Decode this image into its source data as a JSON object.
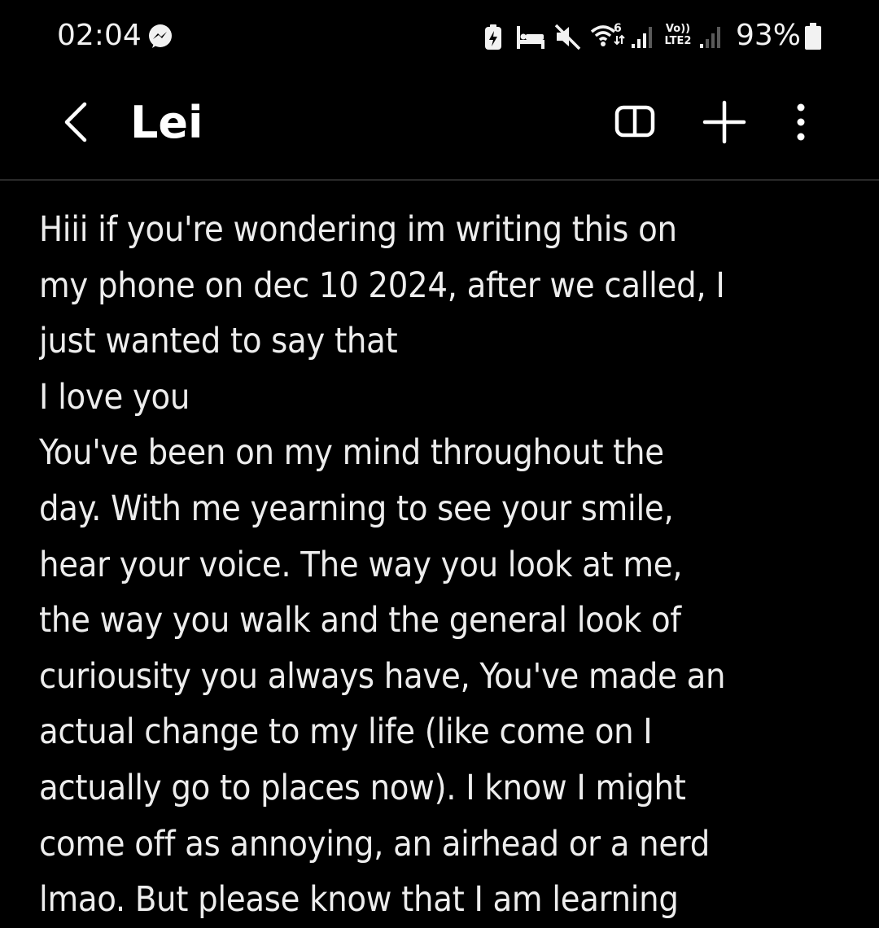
{
  "status_bar": {
    "time": "02:04",
    "battery_percent": "93%",
    "network_label_top": "Vo))",
    "network_label_bottom": "LTE2",
    "wifi_generation": "6",
    "icons": [
      "messenger-icon",
      "battery-saver-icon",
      "bed-icon",
      "mute-icon",
      "wifi-icon",
      "signal-icon",
      "signal-icon-2",
      "battery-icon"
    ]
  },
  "header": {
    "title": "Lei",
    "icons": [
      "back-icon",
      "reading-mode-icon",
      "add-icon",
      "more-options-icon"
    ]
  },
  "note": {
    "lines": [
      "Hiii if you're wondering im writing this on",
      "my phone on dec 10 2024, after we called, I",
      "just wanted to say that",
      "I love you",
      "You've been on my mind throughout the",
      "day. With me yearning to see your smile,",
      "hear your voice. The way you look at me,",
      "the way you walk and the general look of",
      "curiousity you always have, You've made an",
      "actual change to my life (like come on I",
      "actually go to places now). I know I might",
      "come off as annoying, an airhead or a nerd",
      "lmao. But please know that I am learning"
    ]
  },
  "colors": {
    "background": "#000000",
    "text": "#ededed",
    "divider": "#2a2a2a"
  }
}
